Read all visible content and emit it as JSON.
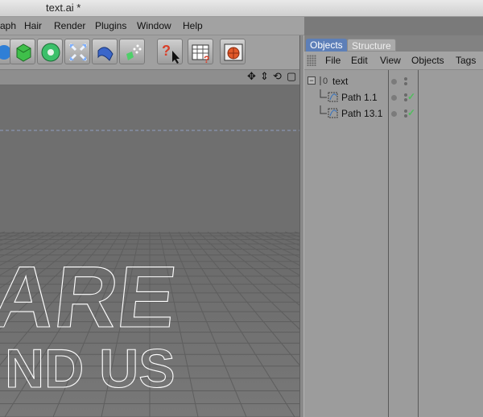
{
  "window": {
    "title": "text.ai *"
  },
  "menubar": {
    "items": [
      "aph",
      "Hair",
      "Render",
      "Plugins",
      "Window",
      "Help"
    ]
  },
  "toolbar": {
    "icons": [
      "sphere-icon",
      "cube-icon",
      "flower-icon",
      "arrows-icon",
      "deformer-icon",
      "particles-icon",
      "help-cursor-icon",
      "schedule-icon",
      "render-icon"
    ]
  },
  "panel": {
    "tabs": [
      {
        "label": "Objects",
        "active": true
      },
      {
        "label": "Structure",
        "active": false
      }
    ],
    "menu": [
      "File",
      "Edit",
      "View",
      "Objects",
      "Tags"
    ],
    "objects": [
      {
        "name": "text",
        "type": "null",
        "check": false
      },
      {
        "name": "Path 1.1",
        "type": "spline",
        "check": true
      },
      {
        "name": "Path 13.1",
        "type": "spline",
        "check": true
      }
    ]
  },
  "viewport": {
    "text_line1": "ARE",
    "text_line2": "ND US"
  },
  "colors": {
    "tab_active": "#5d7fb8",
    "check": "#4fbf5c",
    "viewport_bg": "#6f6f6f"
  }
}
